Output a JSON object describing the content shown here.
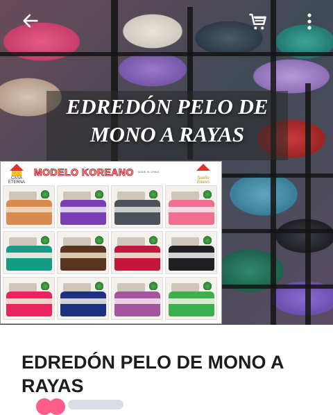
{
  "hero": {
    "overlay_title_line1": "EDREDÓN PELO DE",
    "overlay_title_line2": "MONO A RAYAS"
  },
  "topbar": {
    "back_icon": "arrow-left-icon",
    "cart_icon": "shopping-cart-icon",
    "more_icon": "more-vertical-icon"
  },
  "catalog": {
    "brand_left": "CASA ETERNA",
    "title": "MODELO KOREANO",
    "made_in": "MADE IN CHINA",
    "brand_right": "Sueño Eterno",
    "beds": [
      {
        "color": "#d98b4f",
        "stripe": "#f1d9bd"
      },
      {
        "color": "#7b3fb5",
        "stripe": "#e8dff2"
      },
      {
        "color": "#4b5158",
        "stripe": "#d9d9d9"
      },
      {
        "color": "#ee6f8f",
        "stripe": "#f8e1e7"
      },
      {
        "color": "#159b86",
        "stripe": "#f2eee6"
      },
      {
        "color": "#5b3420",
        "stripe": "#e9d7c0"
      },
      {
        "color": "#c4163a",
        "stripe": "#f1e4d4"
      },
      {
        "color": "#1f1f24",
        "stripe": "#e6e6e6"
      },
      {
        "color": "#e8245f",
        "stripe": "#f5e3d7"
      },
      {
        "color": "#1d2f80",
        "stripe": "#e6e3dc"
      },
      {
        "color": "#a5549f",
        "stripe": "#f1e0ea"
      },
      {
        "color": "#3bb04e",
        "stripe": "#e9f2e2"
      }
    ]
  },
  "product": {
    "title": "EDREDÓN PELO DE MONO A RAYAS"
  }
}
